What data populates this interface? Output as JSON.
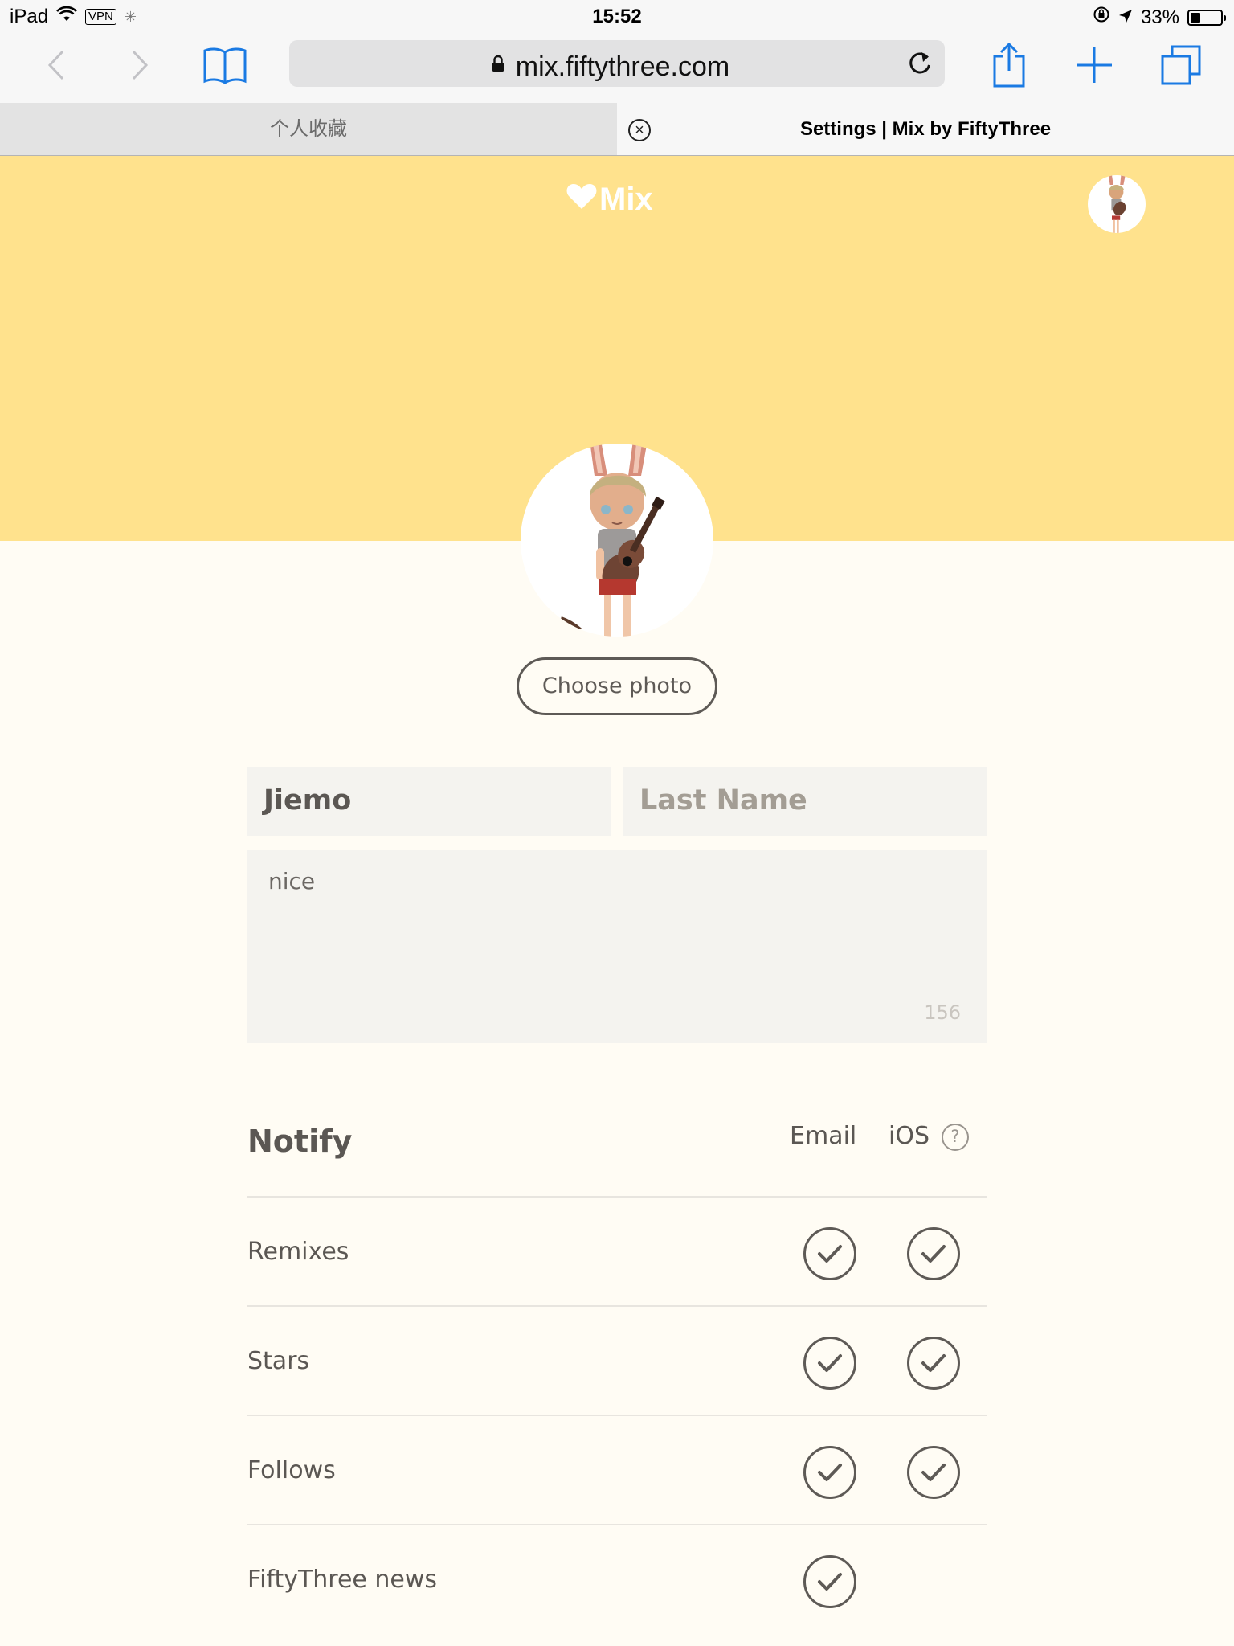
{
  "status_bar": {
    "device": "iPad",
    "vpn": "VPN",
    "time": "15:52",
    "battery": "33%",
    "battery_level": 0.33
  },
  "browser": {
    "url": "mix.fiftythree.com",
    "icons": [
      "back-icon",
      "forward-icon",
      "bookmarks-icon",
      "lock-icon",
      "reload-icon",
      "share-icon",
      "new-tab-icon",
      "tabs-icon"
    ],
    "tabs": [
      {
        "title": "个人收藏"
      },
      {
        "title": "Settings | Mix by FiftyThree"
      }
    ]
  },
  "header": {
    "logo": "Mix",
    "accent_color": "#ffe28d"
  },
  "profile": {
    "choose_photo_label": "Choose photo",
    "first_name": "Jiemo",
    "last_name_placeholder": "Last Name",
    "bio": "nice",
    "bio_remaining": "156"
  },
  "notify": {
    "title": "Notify",
    "col_email": "Email",
    "col_ios": "iOS",
    "rows": [
      {
        "label": "Remixes",
        "email": true,
        "ios": true
      },
      {
        "label": "Stars",
        "email": true,
        "ios": true
      },
      {
        "label": "Follows",
        "email": true,
        "ios": true
      },
      {
        "label": "FiftyThree news",
        "email": true,
        "ios": null
      }
    ]
  }
}
